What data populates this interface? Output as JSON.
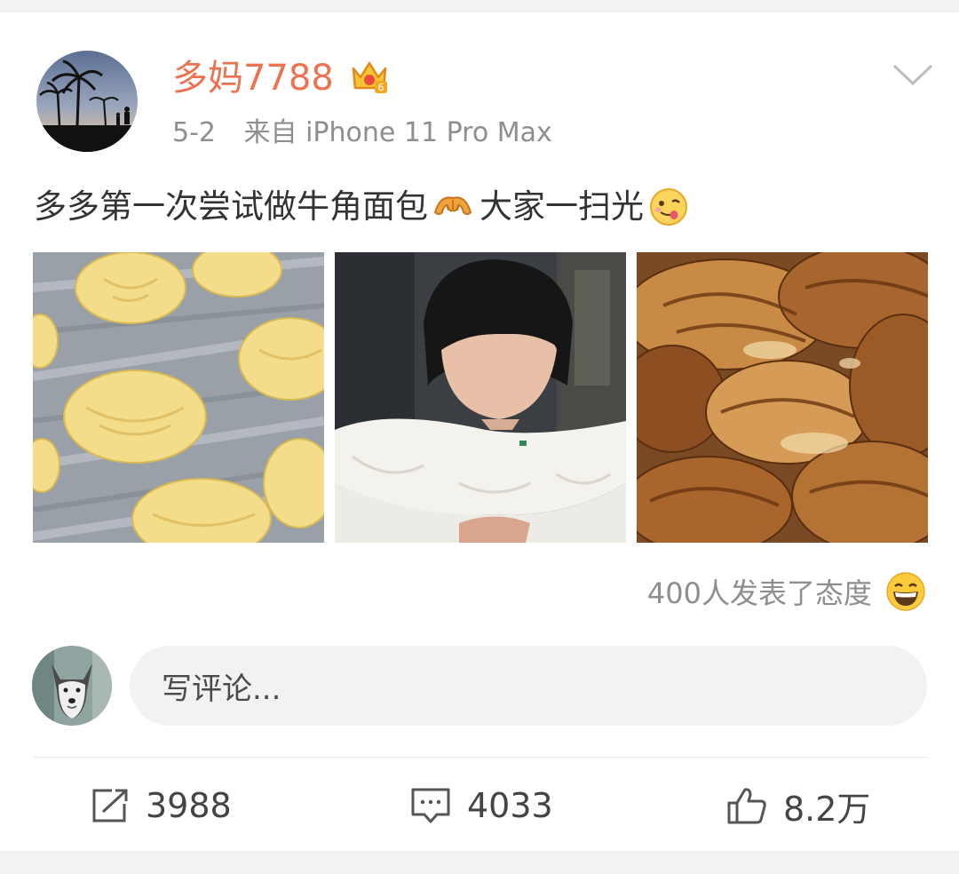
{
  "post": {
    "author": "多妈7788",
    "date": "5-2",
    "source": "来自 iPhone 11 Pro Max",
    "text_part1": "多多第一次尝试做牛角面包",
    "text_part2": " 大家一扫光",
    "inline_emojis": [
      "croissant-emoji",
      "yummy-face-emoji"
    ],
    "photos": [
      "unbaked-croissants-photo",
      "girl-making-croissants-photo",
      "baked-croissants-photo"
    ]
  },
  "reactions": {
    "text": "400人发表了态度",
    "icon": "grinning-face-emoji"
  },
  "comment": {
    "placeholder": "写评论..."
  },
  "actions": {
    "repost_count": "3988",
    "comment_count": "4033",
    "like_count": "8.2万"
  },
  "colors": {
    "author": "#eb7350",
    "meta": "#8e8e8e",
    "text": "#333333",
    "background": "#f2f2f2"
  }
}
